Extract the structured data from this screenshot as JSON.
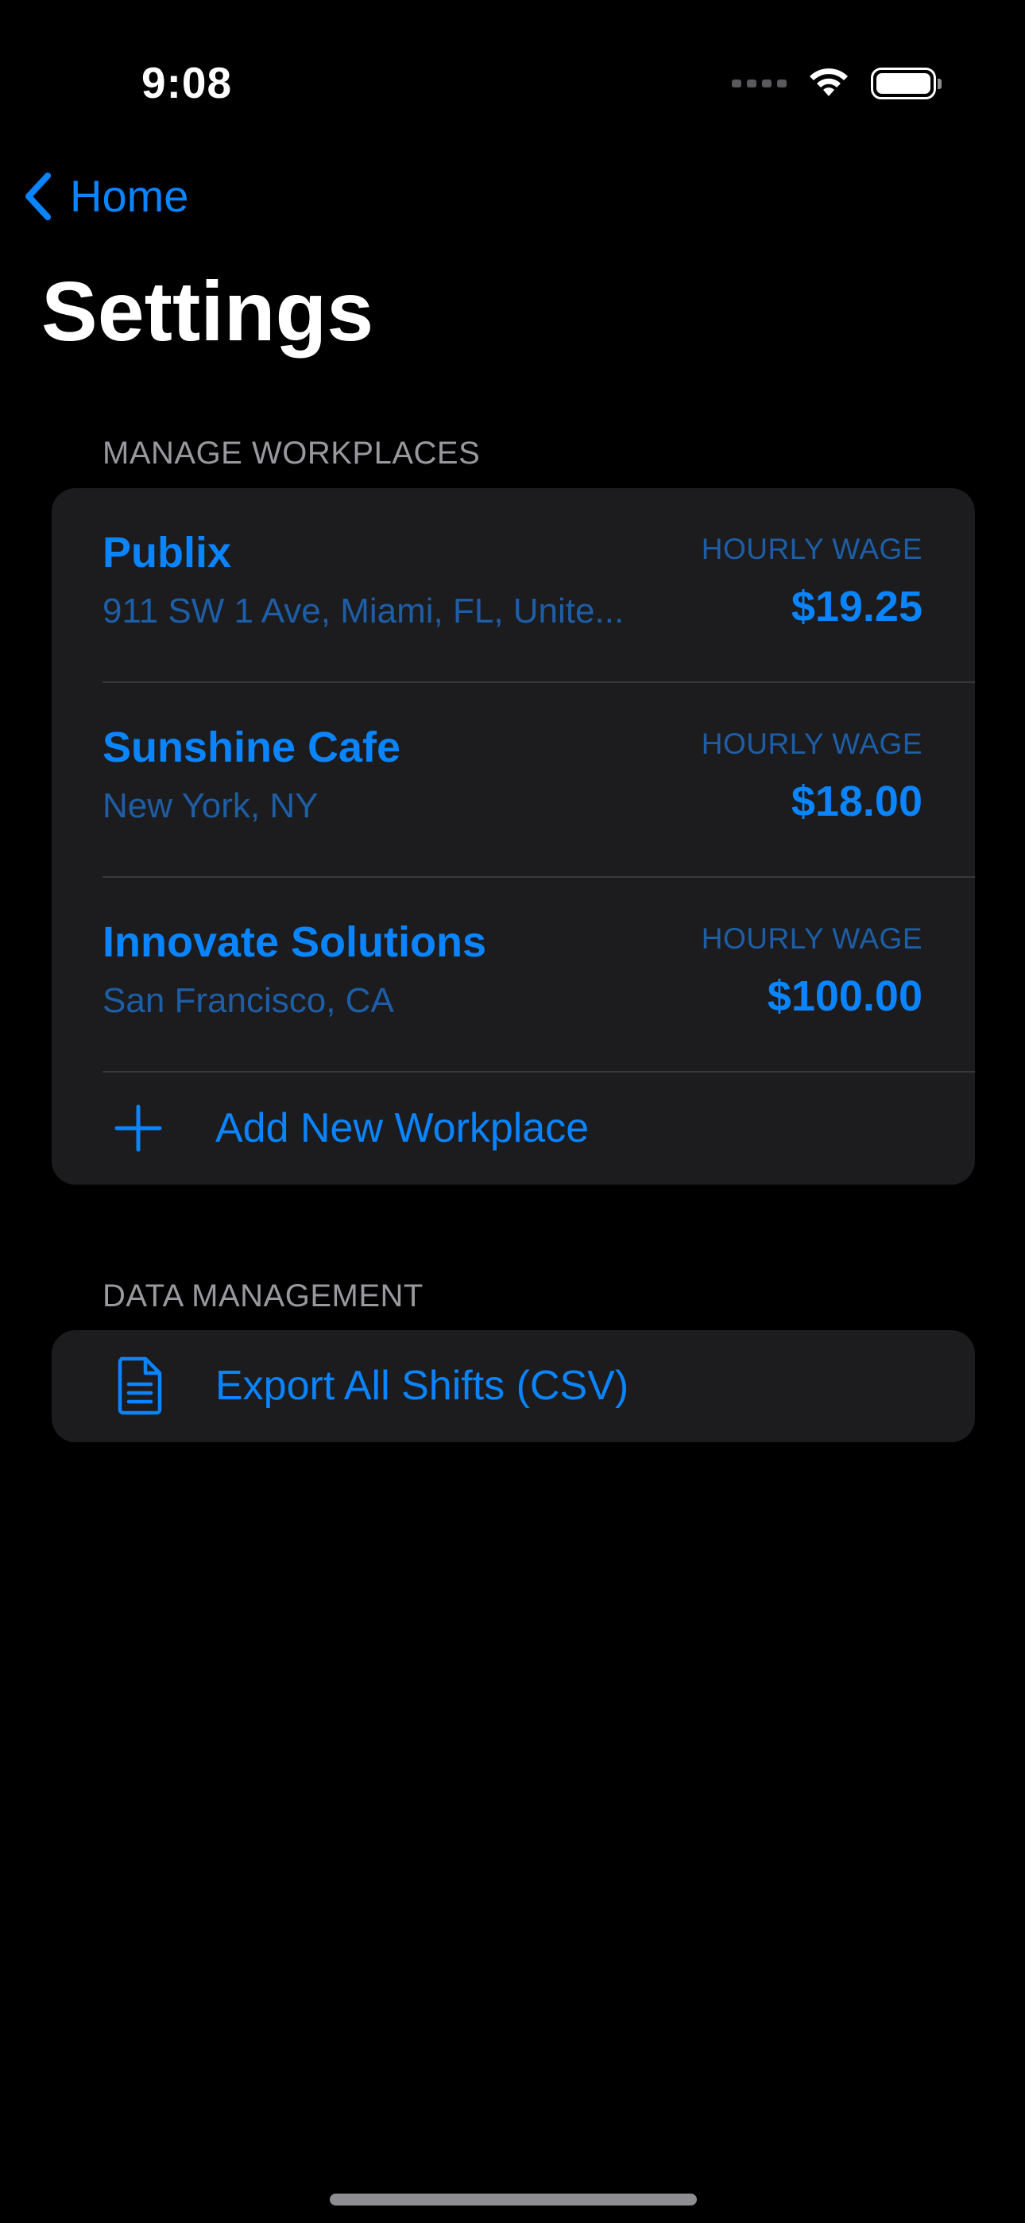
{
  "status_bar": {
    "time": "9:08"
  },
  "nav": {
    "back_label": "Home",
    "title": "Settings"
  },
  "workplaces_section": {
    "header": "MANAGE WORKPLACES",
    "wage_label": "HOURLY WAGE",
    "items": [
      {
        "name": "Publix",
        "address": "911 SW 1 Ave, Miami, FL, Unite...",
        "wage": "$19.25"
      },
      {
        "name": "Sunshine Cafe",
        "address": "New York, NY",
        "wage": "$18.00"
      },
      {
        "name": "Innovate Solutions",
        "address": "San Francisco, CA",
        "wage": "$100.00"
      }
    ],
    "add_label": "Add New Workplace"
  },
  "data_section": {
    "header": "DATA MANAGEMENT",
    "export_label": "Export All Shifts (CSV)"
  },
  "colors": {
    "background": "#000000",
    "card": "#1c1c1e",
    "accent": "#0a84ff",
    "secondary_accent": "#1d5ea6",
    "section_header": "#98989f"
  },
  "icons": {
    "back": "chevron-left-icon",
    "add": "plus-icon",
    "export": "document-icon",
    "wifi": "wifi-icon",
    "battery": "battery-icon",
    "signal": "cellular-signal-icon"
  }
}
